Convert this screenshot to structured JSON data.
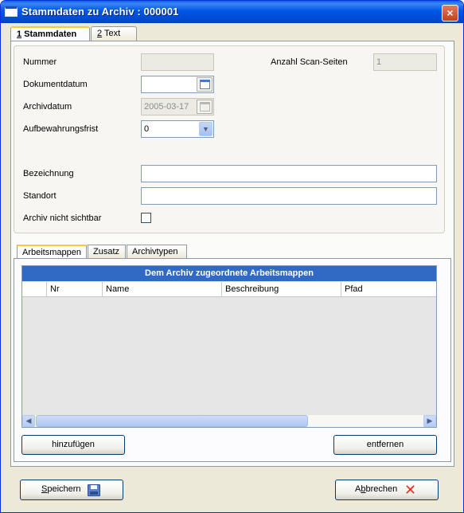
{
  "window": {
    "title": "Stammdaten zu Archiv : 000001",
    "close": "×"
  },
  "main_tabs": [
    {
      "num": "1",
      "label": " Stammdaten"
    },
    {
      "num": "2",
      "label": " Text"
    }
  ],
  "form": {
    "nummer_label": "Nummer",
    "nummer_value": "",
    "scan_label": "Anzahl Scan-Seiten",
    "scan_value": "1",
    "dokumentdatum_label": "Dokumentdatum",
    "dokumentdatum_value": "",
    "archivdatum_label": "Archivdatum",
    "archivdatum_value": "2005-03-17",
    "aufbewahrung_label": "Aufbewahrungsfrist",
    "aufbewahrung_value": "0",
    "bezeichnung_label": "Bezeichnung",
    "bezeichnung_value": "",
    "standort_label": "Standort",
    "standort_value": "",
    "nicht_sichtbar_label": "Archiv nicht sichtbar",
    "nicht_sichtbar_checked": false
  },
  "sub_tabs": [
    "Arbeitsmappen",
    "Zusatz",
    "Archivtypen"
  ],
  "grid": {
    "caption": "Dem Archiv zugeordnete Arbeitsmappen",
    "columns": [
      "",
      "Nr",
      "Name",
      "Beschreibung",
      "Pfad"
    ],
    "rows": []
  },
  "buttons": {
    "add": "hinzufügen",
    "remove": "entfernen",
    "save": "Speichern",
    "save_mnemonic": "S",
    "cancel": "Abbrechen",
    "cancel_mnemonic": "b"
  },
  "colors": {
    "titlebar": "#0058e6",
    "grid_caption": "#316ac5",
    "cancel_icon": "#e3321e"
  }
}
